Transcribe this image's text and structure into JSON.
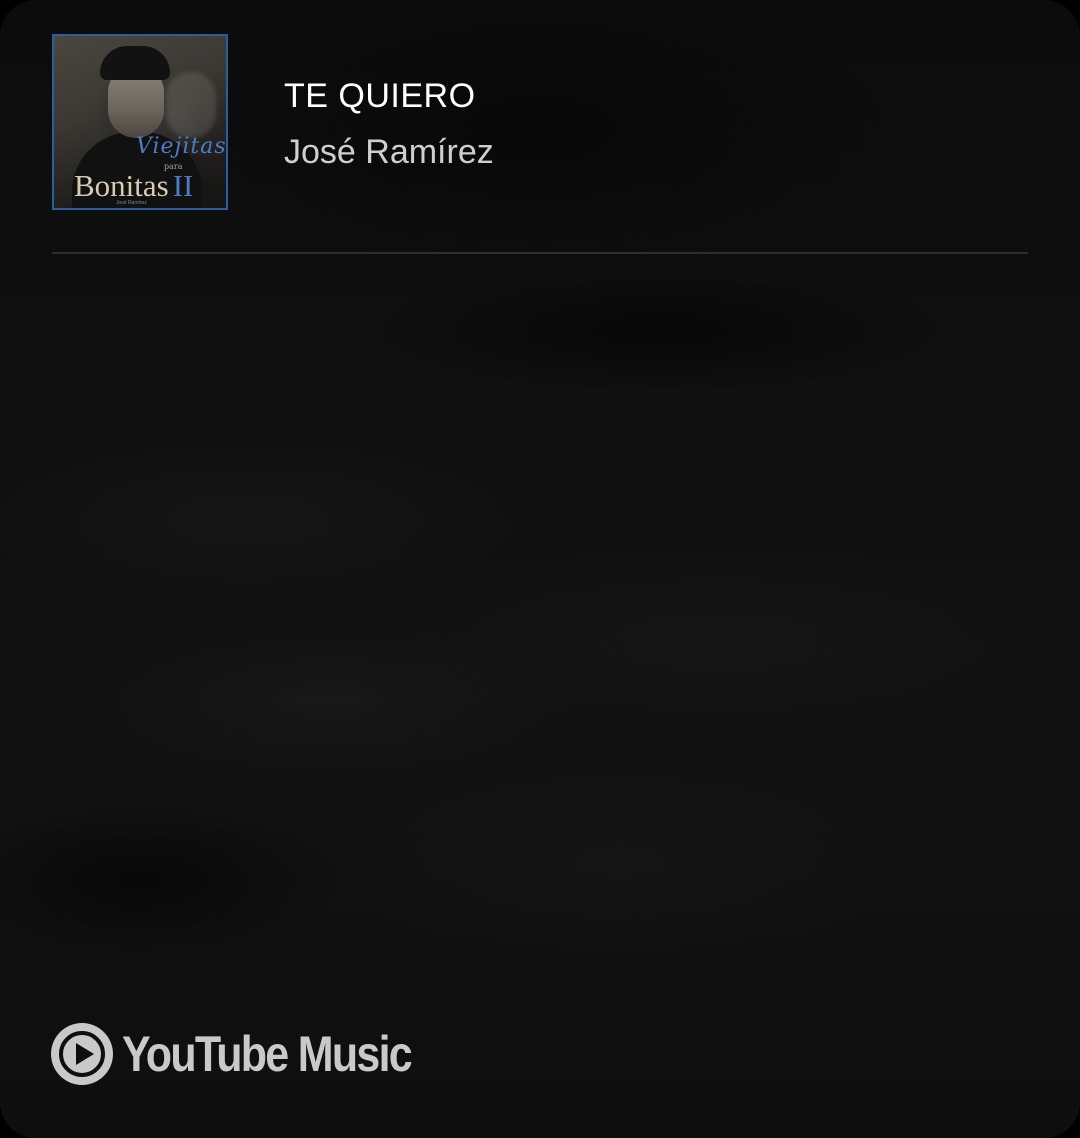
{
  "now_playing": {
    "title": "TE QUIERO",
    "artist": "José Ramírez"
  },
  "album_art": {
    "script_text": "Viejitas",
    "small_text": "para",
    "main_text": "Bonitas",
    "numeral": "II",
    "credit": "José Ramírez"
  },
  "branding": {
    "name": "YouTube Music",
    "icon": "youtube-music-play-icon"
  },
  "colors": {
    "background": "#0d0d0d",
    "title": "#ffffff",
    "artist": "#cfcfcf",
    "divider": "#2e2e2e",
    "brand": "#c9c9c9",
    "art_accent": "#2c5e9e"
  }
}
